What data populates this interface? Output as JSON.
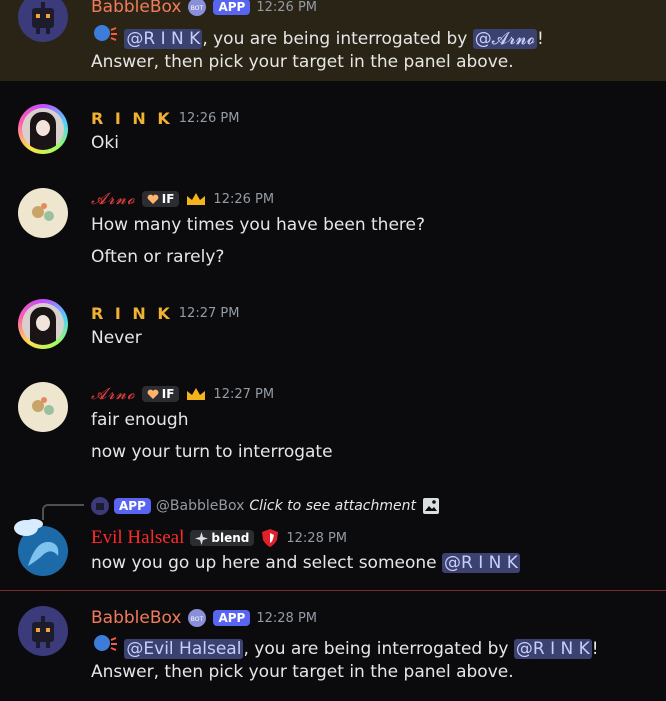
{
  "messages": [
    {
      "name": "BabbleBox",
      "badge": "APP",
      "time": "12:26 PM",
      "mention_rink": "@R I N K",
      "text_a": ", you are being interrogated by ",
      "mention_arno": "@𝓐𝓻𝓷𝓸",
      "text_b": "!",
      "line2": "Answer, then pick your target in the panel above."
    },
    {
      "name": "R I N K",
      "time": "12:26 PM",
      "line1": "Oki"
    },
    {
      "name": "𝓐𝓻𝓷𝓸",
      "tag": "IF",
      "time": "12:26 PM",
      "line1": "How many times you have been there?",
      "line2": "Often or rarely?"
    },
    {
      "name": "R I N K",
      "time": "12:27 PM",
      "line1": "Never"
    },
    {
      "name": "𝓐𝓻𝓷𝓸",
      "tag": "IF",
      "time": "12:27 PM",
      "line1": "fair enough",
      "line2": "now your turn to interrogate"
    },
    {
      "reply_badge": "APP",
      "reply_name": "@BabbleBox",
      "reply_text": "Click to see attachment",
      "name": "Evil Halseal",
      "tag": "blend",
      "time": "12:28 PM",
      "text_a": "now you go up here and select someone ",
      "mention": "@R I N K"
    },
    {
      "name": "BabbleBox",
      "badge": "APP",
      "time": "12:28 PM",
      "mention_evil": "@Evil Halseal",
      "text_a": ", you are being interrogated by ",
      "mention_rink": "@R I N K",
      "text_b": "!",
      "line2": "Answer, then pick your target in the panel above."
    }
  ],
  "colors": {
    "background": "#0b0b0d",
    "highlight": "#2a2417",
    "mention_bg": "#3c4270",
    "app_badge": "#5865f2",
    "rink_name": "#f0b232",
    "arno_name": "#d43b3b",
    "babblebox_name": "#f27b5a",
    "evil_name": "#ff2a2a"
  },
  "icons": [
    "robot-avatar-icon",
    "bot-verified-badge-icon",
    "speaking-head-icon",
    "heart-tag-icon",
    "crown-icon",
    "sparkle-tag-icon",
    "red-shield-icon",
    "image-attachment-icon"
  ]
}
